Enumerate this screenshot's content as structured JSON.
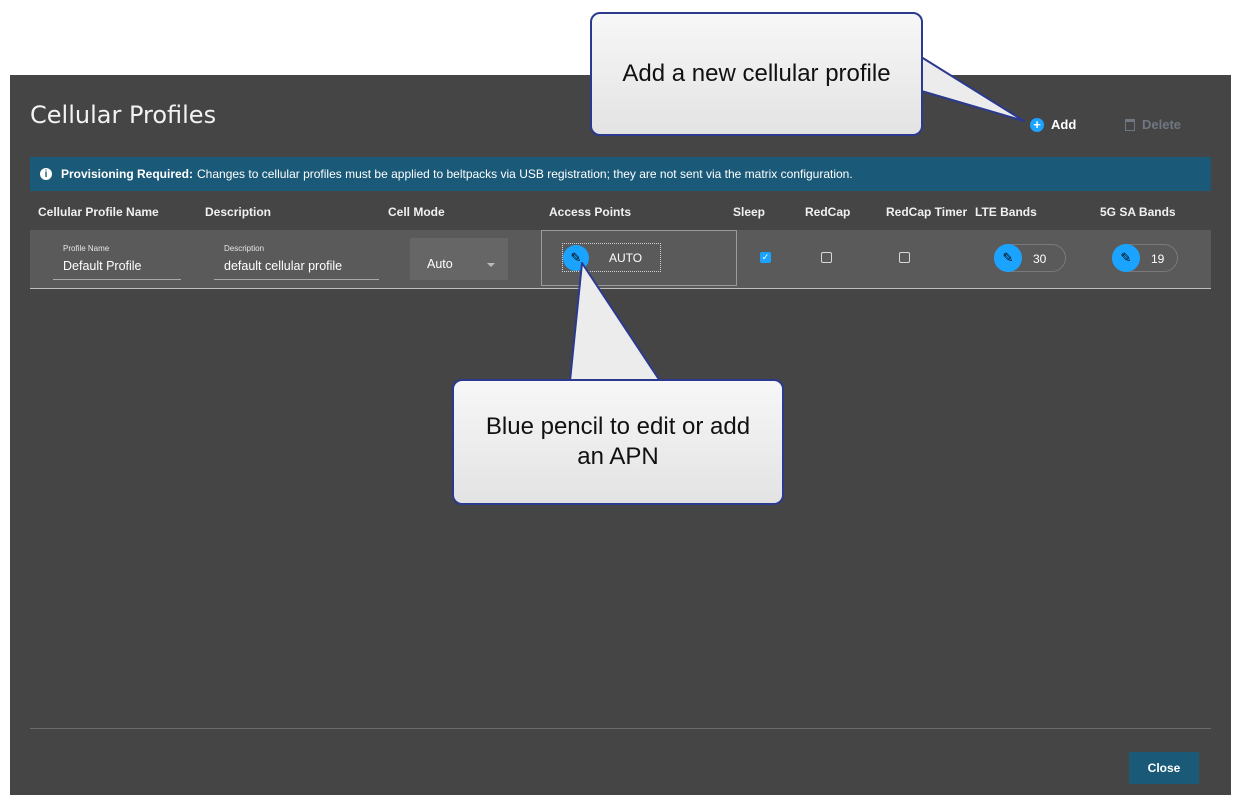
{
  "dialog": {
    "title": "Cellular Profiles",
    "add_label": "Add",
    "delete_label": "Delete",
    "banner": {
      "bold": "Provisioning Required:",
      "text": "Changes to cellular profiles must be applied to beltpacks via USB registration; they are not sent via the matrix configuration."
    },
    "columns": [
      "Cellular Profile Name",
      "Description",
      "Cell Mode",
      "Access Points",
      "Sleep",
      "RedCap",
      "RedCap Timer",
      "LTE Bands",
      "5G SA Bands"
    ],
    "row": {
      "profile_label": "Profile Name",
      "profile_value": "Default Profile",
      "description_label": "Description",
      "description_value": "default cellular profile",
      "cell_mode": "Auto",
      "access_point": "AUTO",
      "sleep": true,
      "redcap": false,
      "redcap_timer": false,
      "lte_bands": "30",
      "sa_bands": "19"
    },
    "close_label": "Close"
  },
  "callouts": {
    "add": "Add a new cellular profile",
    "pencil": "Blue pencil to edit or add an APN"
  },
  "colors": {
    "accent": "#1aa3ff",
    "banner": "#1a5a78",
    "dialog_bg": "#454545"
  }
}
